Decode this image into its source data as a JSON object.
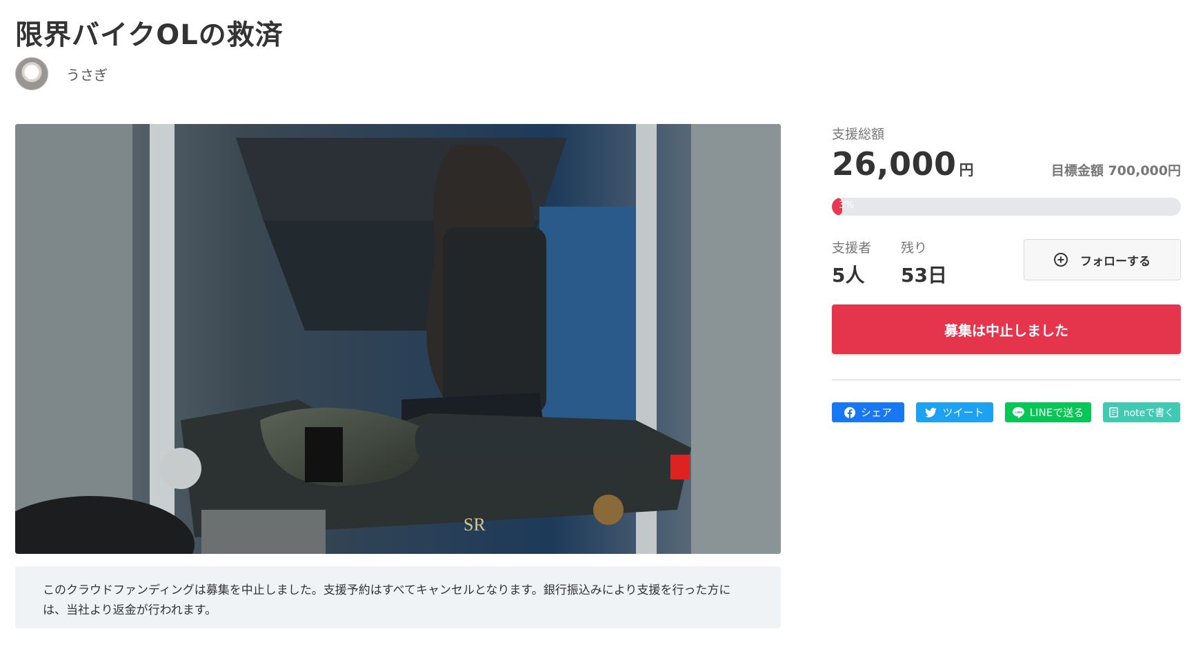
{
  "project": {
    "title": "限界バイクOLの救済",
    "owner_name": "うさぎ"
  },
  "notice": {
    "text": "このクラウドファンディングは募集を中止しました。支援予約はすべてキャンセルとなります。銀行振込みにより支援を行った方には、当社より返金が行われます。"
  },
  "funding": {
    "total_label": "支援総額",
    "amount": "26,000",
    "currency": "円",
    "goal_text": "目標金額 700,000円",
    "progress_percent": 3,
    "progress_label": "3%",
    "supporters_label": "支援者",
    "supporters_value": "5人",
    "remaining_label": "残り",
    "remaining_value": "53日",
    "follow_label": "フォローする",
    "status_label": "募集は中止しました"
  },
  "share": {
    "facebook": "シェア",
    "twitter": "ツイート",
    "line": "LINEで送る",
    "note": "noteで書く"
  },
  "colors": {
    "accent_red": "#e5354d",
    "facebook": "#1877f2",
    "twitter": "#1da1f2",
    "line": "#06c755",
    "note": "#41c9b4"
  },
  "icons": {
    "follow": "plus-circle-icon",
    "facebook": "facebook-icon",
    "twitter": "twitter-bird-icon",
    "line": "line-icon",
    "note": "note-icon"
  }
}
